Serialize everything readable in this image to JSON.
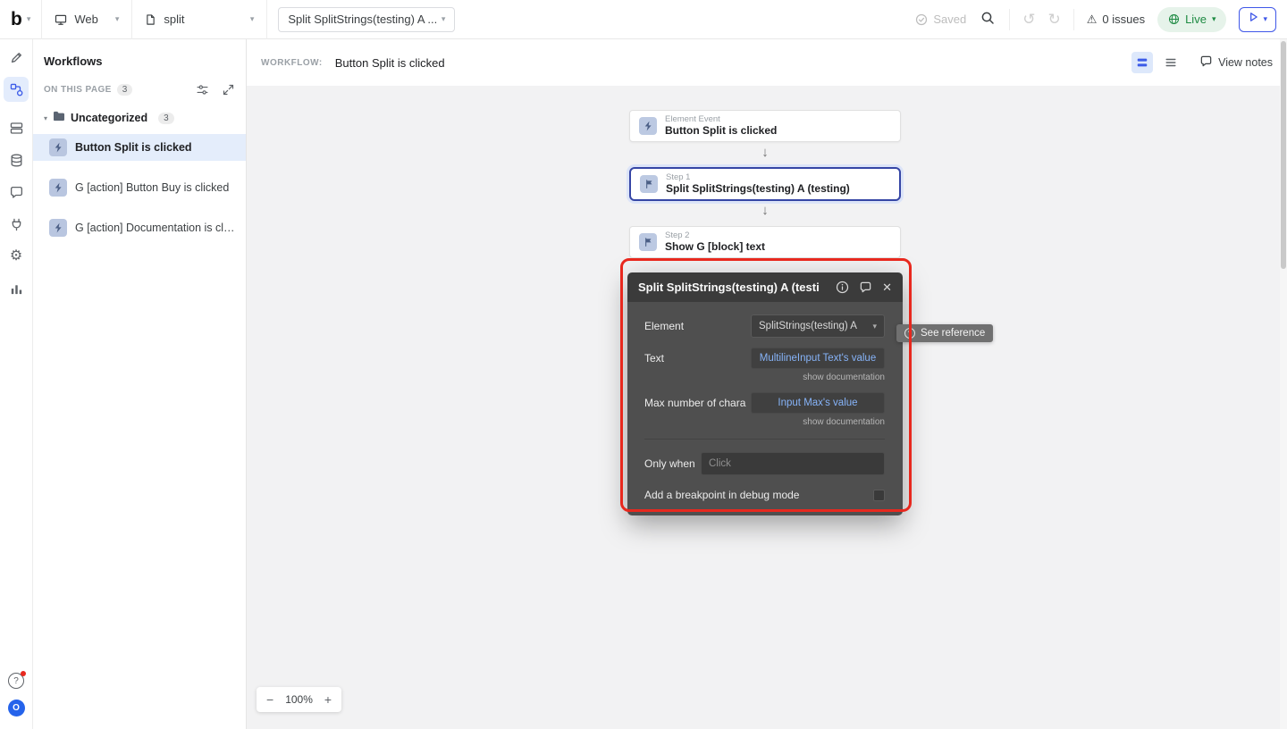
{
  "icons": {
    "chevron_down": "▾",
    "arrow_down": "↓",
    "undo": "↺",
    "redo": "↻",
    "warning": "⚠",
    "gear": "⚙",
    "close": "✕",
    "minus": "−",
    "plus": "+",
    "question": "?"
  },
  "topbar": {
    "logo": "b",
    "app_mode": "Web",
    "page_name": "split",
    "workflow_selector": "Split SplitStrings(testing) A ...",
    "saved": "Saved",
    "issues": "0 issues",
    "live": "Live"
  },
  "rail": {
    "avatar": "O"
  },
  "panel": {
    "title": "Workflows",
    "section_label": "ON THIS PAGE",
    "section_count": "3",
    "folder": {
      "name": "Uncategorized",
      "count": "3"
    },
    "items": [
      {
        "label": "Button Split is clicked"
      },
      {
        "label": "G [action] Button Buy is clicked"
      },
      {
        "label": "G [action] Documentation is click..."
      }
    ]
  },
  "canvas": {
    "workflow_label": "WORKFLOW:",
    "workflow_name": "Button Split is clicked",
    "view_notes": "View notes",
    "zoom_level": "100%"
  },
  "nodes": [
    {
      "kind": "Element Event",
      "title": "Button Split is clicked"
    },
    {
      "kind": "Step 1",
      "title": "Split SplitStrings(testing) A (testing)"
    },
    {
      "kind": "Step 2",
      "title": "Show G [block] text"
    }
  ],
  "popup": {
    "title": "Split SplitStrings(testing) A (testi",
    "element_label": "Element",
    "element_value": "SplitStrings(testing) A",
    "text_label": "Text",
    "text_value": "MultilineInput Text's value",
    "text_doc": "show documentation",
    "max_label": "Max number of chara",
    "max_value": "Input Max's value",
    "max_doc": "show documentation",
    "only_when_label": "Only when",
    "only_when_placeholder": "Click",
    "breakpoint_label": "Add a breakpoint in debug mode",
    "see_reference": "See reference"
  }
}
